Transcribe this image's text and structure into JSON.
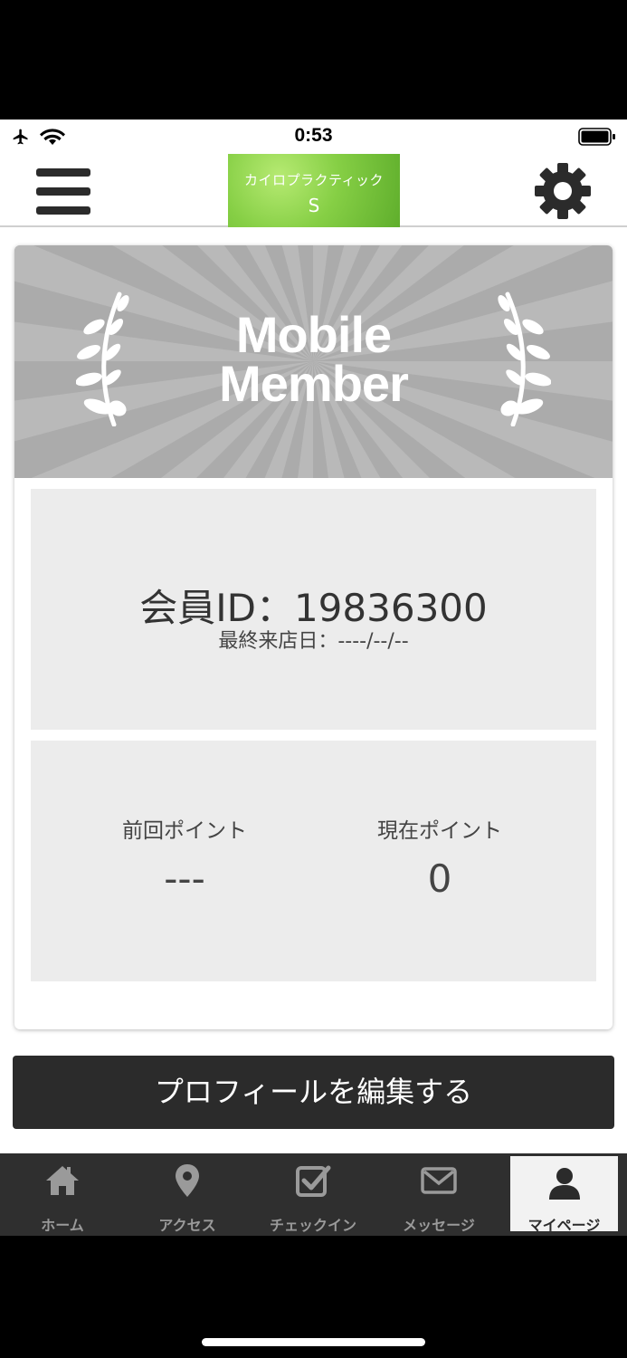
{
  "status_bar": {
    "time": "0:53"
  },
  "header": {
    "logo_line1": "カイロプラクティック",
    "logo_line2": "S"
  },
  "card": {
    "banner_title_line1": "Mobile",
    "banner_title_line2": "Member",
    "member_id": "会員ID：19836300",
    "last_visit": "最終来店日：----/--/--",
    "previous_points_label": "前回ポイント",
    "previous_points_value": "---",
    "current_points_label": "現在ポイント",
    "current_points_value": "0"
  },
  "edit_profile_label": "プロフィールを編集する",
  "tabs": [
    {
      "label": "ホーム",
      "icon": "home-icon"
    },
    {
      "label": "アクセス",
      "icon": "map-pin-icon"
    },
    {
      "label": "チェックイン",
      "icon": "checkbox-icon"
    },
    {
      "label": "メッセージ",
      "icon": "envelope-icon"
    },
    {
      "label": "マイページ",
      "icon": "user-icon",
      "active": true
    }
  ],
  "colors": {
    "banner_gray": "#ababab",
    "panel_gray": "#ececec",
    "dark": "#2b2b2b",
    "logo_green": "#86cf45"
  }
}
